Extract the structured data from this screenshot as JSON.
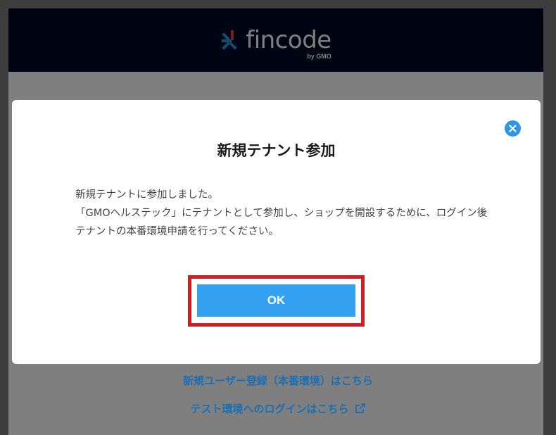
{
  "header": {
    "logo_text": "fincode",
    "logo_by": "by GMO",
    "logo_icon": "fincode-logo-icon"
  },
  "background_links": {
    "register": "新規ユーザー登録（本番環境）はこちら",
    "test_login": "テスト環境へのログインはこちら",
    "test_login_icon": "external-link-icon"
  },
  "modal": {
    "title": "新規テナント参加",
    "message_line1": "新規テナントに参加しました。",
    "message_line2": "「GMOヘルステック」にテナントとして参加し、ショップを開設するために、ログイン後テナントの本番環境申請を行ってください。",
    "ok_label": "OK",
    "close_icon": "close-icon"
  },
  "colors": {
    "header_bg": "#000a28",
    "accent_blue": "#33a0f0",
    "highlight_red": "#d21e1e",
    "link_blue": "#1b6fb5"
  }
}
